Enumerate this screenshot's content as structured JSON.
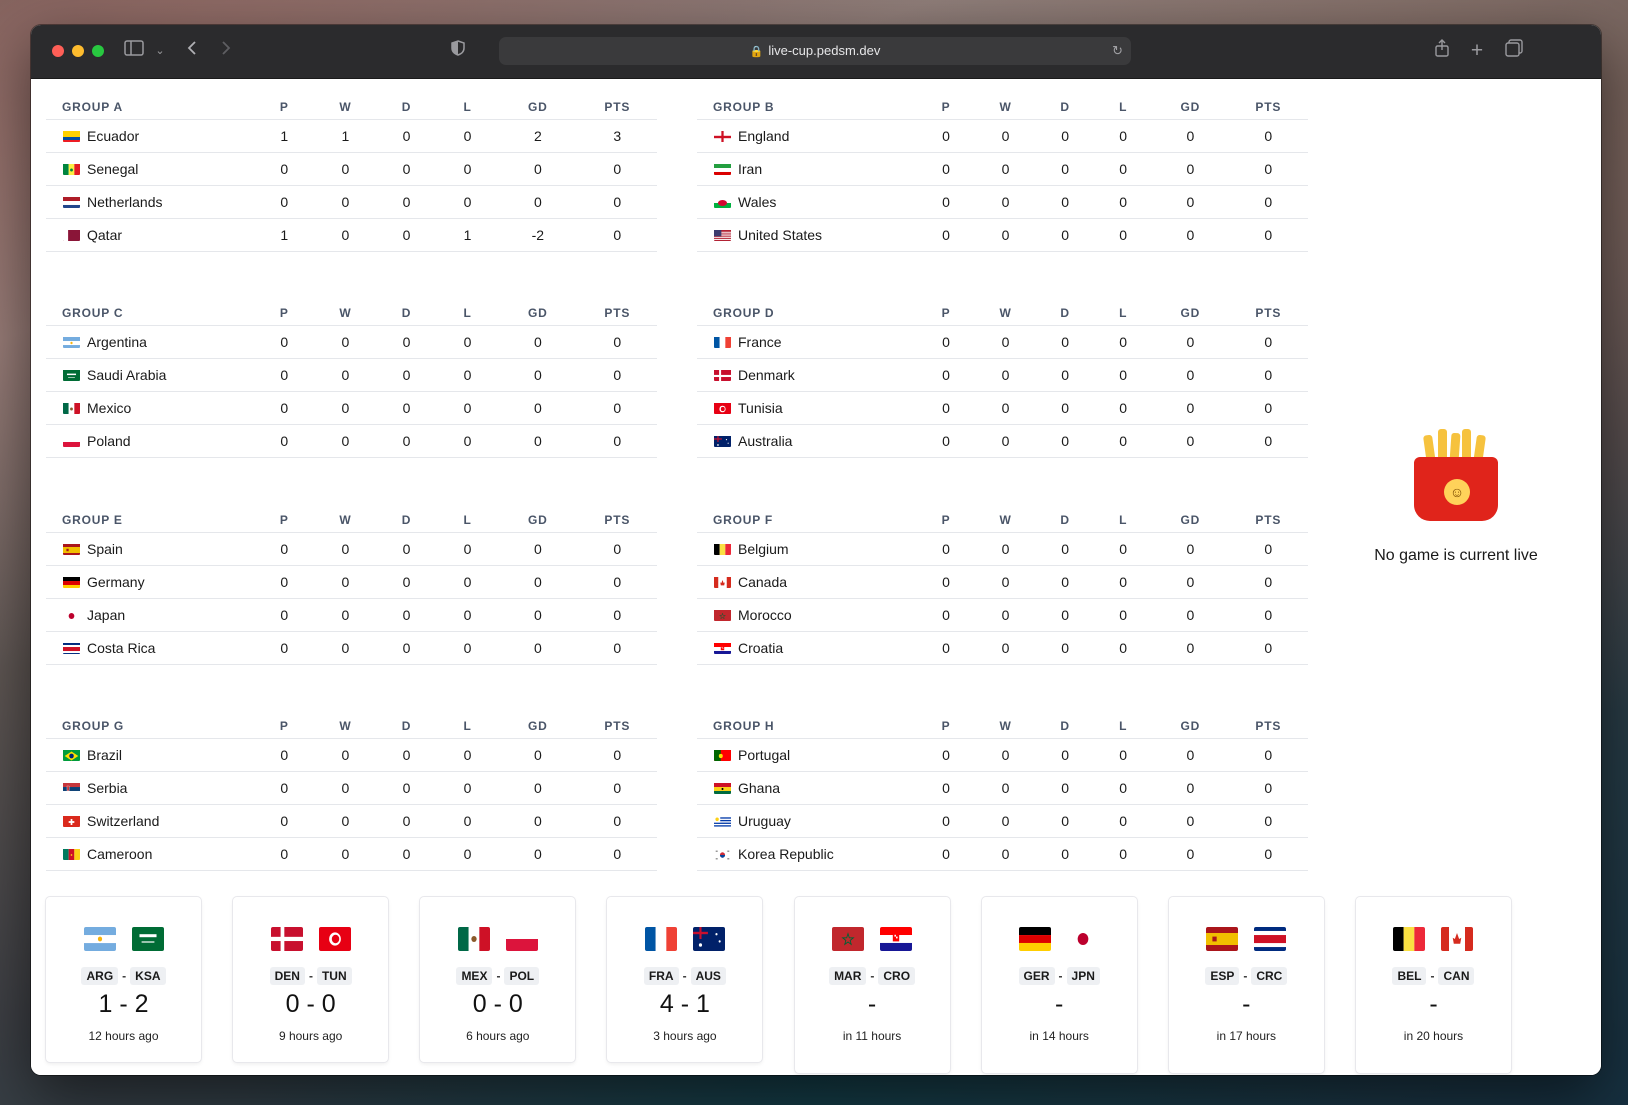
{
  "browser": {
    "url": "live-cup.pedsm.dev"
  },
  "table_headers": [
    "P",
    "W",
    "D",
    "L",
    "GD",
    "PTS"
  ],
  "groups": [
    {
      "name": "GROUP A",
      "teams": [
        {
          "name": "Ecuador",
          "flag": "ecu",
          "stats": [
            "1",
            "1",
            "0",
            "0",
            "2",
            "3"
          ]
        },
        {
          "name": "Senegal",
          "flag": "sen",
          "stats": [
            "0",
            "0",
            "0",
            "0",
            "0",
            "0"
          ]
        },
        {
          "name": "Netherlands",
          "flag": "ned",
          "stats": [
            "0",
            "0",
            "0",
            "0",
            "0",
            "0"
          ]
        },
        {
          "name": "Qatar",
          "flag": "qat",
          "stats": [
            "1",
            "0",
            "0",
            "1",
            "-2",
            "0"
          ]
        }
      ]
    },
    {
      "name": "GROUP B",
      "teams": [
        {
          "name": "England",
          "flag": "eng",
          "stats": [
            "0",
            "0",
            "0",
            "0",
            "0",
            "0"
          ]
        },
        {
          "name": "Iran",
          "flag": "irn",
          "stats": [
            "0",
            "0",
            "0",
            "0",
            "0",
            "0"
          ]
        },
        {
          "name": "Wales",
          "flag": "wal",
          "stats": [
            "0",
            "0",
            "0",
            "0",
            "0",
            "0"
          ]
        },
        {
          "name": "United States",
          "flag": "usa",
          "stats": [
            "0",
            "0",
            "0",
            "0",
            "0",
            "0"
          ]
        }
      ]
    },
    {
      "name": "GROUP C",
      "teams": [
        {
          "name": "Argentina",
          "flag": "arg",
          "stats": [
            "0",
            "0",
            "0",
            "0",
            "0",
            "0"
          ]
        },
        {
          "name": "Saudi Arabia",
          "flag": "ksa",
          "stats": [
            "0",
            "0",
            "0",
            "0",
            "0",
            "0"
          ]
        },
        {
          "name": "Mexico",
          "flag": "mex",
          "stats": [
            "0",
            "0",
            "0",
            "0",
            "0",
            "0"
          ]
        },
        {
          "name": "Poland",
          "flag": "pol",
          "stats": [
            "0",
            "0",
            "0",
            "0",
            "0",
            "0"
          ]
        }
      ]
    },
    {
      "name": "GROUP D",
      "teams": [
        {
          "name": "France",
          "flag": "fra",
          "stats": [
            "0",
            "0",
            "0",
            "0",
            "0",
            "0"
          ]
        },
        {
          "name": "Denmark",
          "flag": "den",
          "stats": [
            "0",
            "0",
            "0",
            "0",
            "0",
            "0"
          ]
        },
        {
          "name": "Tunisia",
          "flag": "tun",
          "stats": [
            "0",
            "0",
            "0",
            "0",
            "0",
            "0"
          ]
        },
        {
          "name": "Australia",
          "flag": "aus",
          "stats": [
            "0",
            "0",
            "0",
            "0",
            "0",
            "0"
          ]
        }
      ]
    },
    {
      "name": "GROUP E",
      "teams": [
        {
          "name": "Spain",
          "flag": "esp",
          "stats": [
            "0",
            "0",
            "0",
            "0",
            "0",
            "0"
          ]
        },
        {
          "name": "Germany",
          "flag": "ger",
          "stats": [
            "0",
            "0",
            "0",
            "0",
            "0",
            "0"
          ]
        },
        {
          "name": "Japan",
          "flag": "jpn",
          "stats": [
            "0",
            "0",
            "0",
            "0",
            "0",
            "0"
          ]
        },
        {
          "name": "Costa Rica",
          "flag": "crc",
          "stats": [
            "0",
            "0",
            "0",
            "0",
            "0",
            "0"
          ]
        }
      ]
    },
    {
      "name": "GROUP F",
      "teams": [
        {
          "name": "Belgium",
          "flag": "bel",
          "stats": [
            "0",
            "0",
            "0",
            "0",
            "0",
            "0"
          ]
        },
        {
          "name": "Canada",
          "flag": "can",
          "stats": [
            "0",
            "0",
            "0",
            "0",
            "0",
            "0"
          ]
        },
        {
          "name": "Morocco",
          "flag": "mar",
          "stats": [
            "0",
            "0",
            "0",
            "0",
            "0",
            "0"
          ]
        },
        {
          "name": "Croatia",
          "flag": "cro",
          "stats": [
            "0",
            "0",
            "0",
            "0",
            "0",
            "0"
          ]
        }
      ]
    },
    {
      "name": "GROUP G",
      "teams": [
        {
          "name": "Brazil",
          "flag": "bra",
          "stats": [
            "0",
            "0",
            "0",
            "0",
            "0",
            "0"
          ]
        },
        {
          "name": "Serbia",
          "flag": "srb",
          "stats": [
            "0",
            "0",
            "0",
            "0",
            "0",
            "0"
          ]
        },
        {
          "name": "Switzerland",
          "flag": "sui",
          "stats": [
            "0",
            "0",
            "0",
            "0",
            "0",
            "0"
          ]
        },
        {
          "name": "Cameroon",
          "flag": "cmr",
          "stats": [
            "0",
            "0",
            "0",
            "0",
            "0",
            "0"
          ]
        }
      ]
    },
    {
      "name": "GROUP H",
      "teams": [
        {
          "name": "Portugal",
          "flag": "por",
          "stats": [
            "0",
            "0",
            "0",
            "0",
            "0",
            "0"
          ]
        },
        {
          "name": "Ghana",
          "flag": "gha",
          "stats": [
            "0",
            "0",
            "0",
            "0",
            "0",
            "0"
          ]
        },
        {
          "name": "Uruguay",
          "flag": "uru",
          "stats": [
            "0",
            "0",
            "0",
            "0",
            "0",
            "0"
          ]
        },
        {
          "name": "Korea Republic",
          "flag": "kor",
          "stats": [
            "0",
            "0",
            "0",
            "0",
            "0",
            "0"
          ]
        }
      ]
    }
  ],
  "live": {
    "icon": "french-fries-icon",
    "message": "No game is current live"
  },
  "games": [
    {
      "home": "ARG",
      "away": "KSA",
      "home_flag": "arg",
      "away_flag": "ksa",
      "score": "1 - 2",
      "time": "12 hours ago"
    },
    {
      "home": "DEN",
      "away": "TUN",
      "home_flag": "den",
      "away_flag": "tun",
      "score": "0 - 0",
      "time": "9 hours ago"
    },
    {
      "home": "MEX",
      "away": "POL",
      "home_flag": "mex",
      "away_flag": "pol",
      "score": "0 - 0",
      "time": "6 hours ago"
    },
    {
      "home": "FRA",
      "away": "AUS",
      "home_flag": "fra",
      "away_flag": "aus",
      "score": "4 - 1",
      "time": "3 hours ago"
    },
    {
      "home": "MAR",
      "away": "CRO",
      "home_flag": "mar",
      "away_flag": "cro",
      "score": "-",
      "time": "in 11 hours"
    },
    {
      "home": "GER",
      "away": "JPN",
      "home_flag": "ger",
      "away_flag": "jpn",
      "score": "-",
      "time": "in 14 hours"
    },
    {
      "home": "ESP",
      "away": "CRC",
      "home_flag": "esp",
      "away_flag": "crc",
      "score": "-",
      "time": "in 17 hours"
    },
    {
      "home": "BEL",
      "away": "CAN",
      "home_flag": "bel",
      "away_flag": "can",
      "score": "-",
      "time": "in 20 hours"
    }
  ]
}
